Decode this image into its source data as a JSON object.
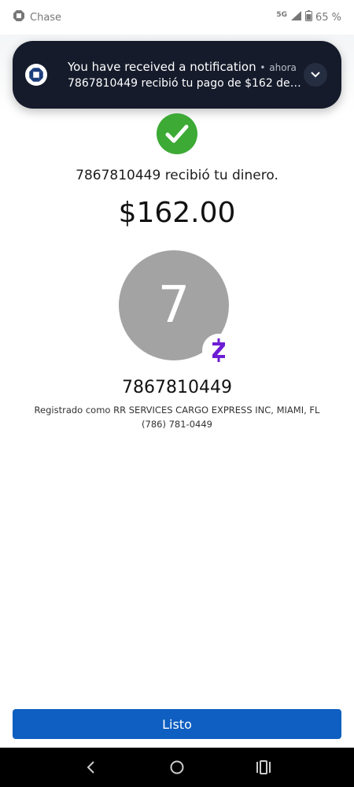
{
  "status_bar": {
    "app_name": "Chase",
    "network": "5G",
    "battery": "65 %"
  },
  "notification": {
    "title": "You have received a notification",
    "separator": "•",
    "time": "ahora",
    "body": "7867810449 recibió tu pago de $162 de Ch..."
  },
  "confirmation": {
    "received_text": "7867810449 recibió tu dinero.",
    "amount": "$162.00",
    "avatar_initial": "7",
    "recipient": "7867810449",
    "registered_as": "Registrado como RR SERVICES CARGO EXPRESS INC, MIAMI, FL",
    "phone": "(786) 781-0449"
  },
  "actions": {
    "done_label": "Listo"
  },
  "colors": {
    "success_green": "#3daa35",
    "button_blue": "#0e5fc1",
    "zelle_purple": "#6d1ed4",
    "notification_bg": "#151b2b"
  },
  "icons": {
    "status_app": "chase-logo-icon",
    "check": "check-circle-icon",
    "zelle": "zelle-icon",
    "nav_back": "back-icon",
    "nav_home": "home-icon",
    "nav_recents": "recents-icon"
  }
}
